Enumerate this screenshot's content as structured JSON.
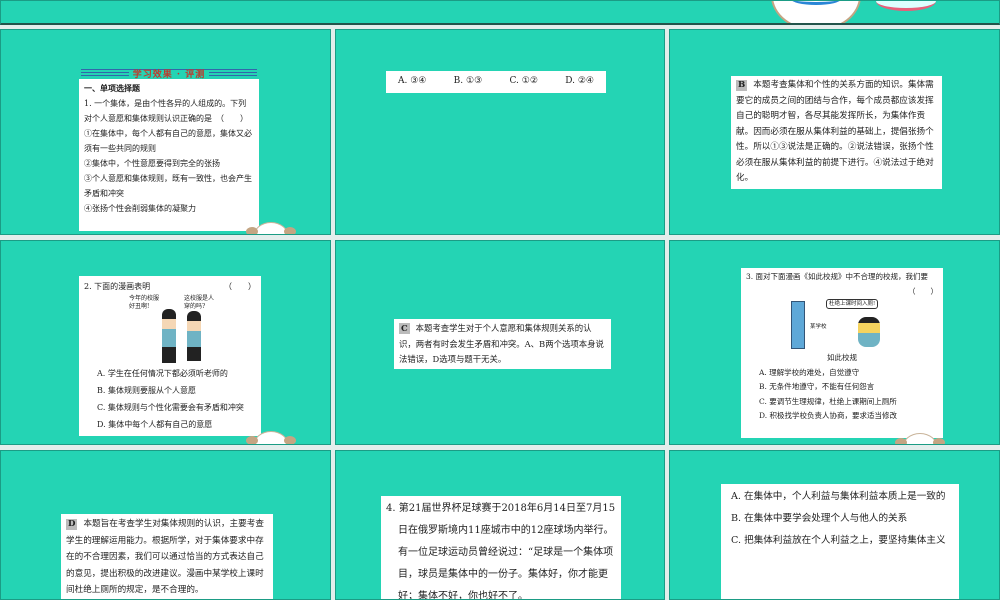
{
  "slide1": {
    "header": "学习效果 · 评测",
    "section": "一、单项选择题",
    "q": "1. 一个集体，是由个性各异的人组成的。下列对个人意愿和集体规则认识正确的是　（　　）",
    "opts": [
      "①在集体中，每个人都有自己的意愿，集体又必须有一些共同的规则",
      "②集体中，个性意愿要得到完全的张扬",
      "③个人意愿和集体规则，既有一致性，也会产生矛盾和冲突",
      "④张扬个性会削弱集体的凝聚力"
    ]
  },
  "slide2": {
    "opts": [
      "A. ③④",
      "B. ①③",
      "C. ①②",
      "D. ②④"
    ]
  },
  "slide3": {
    "tag": "B",
    "text": "本题考查集体和个性的关系方面的知识。集体需要它的成员之间的团结与合作，每个成员都应该发挥自己的聪明才智，各尽其能发挥所长，为集体作贡献。因而必须在服从集体利益的基础上，提倡张扬个性。所以①③说法是正确的。②说法错误，张扬个性必须在服从集体利益的前提下进行。④说法过于绝对化。"
  },
  "slide4": {
    "q": "2. 下面的漫画表明",
    "paren": "（　　）",
    "bubble1": "今年的校服好丑啊!",
    "bubble2": "这校服是人穿的吗?",
    "opts": [
      "A. 学生在任何情况下都必须听老师的",
      "B. 集体规则要服从个人意愿",
      "C. 集体规则与个性化需要会有矛盾和冲突",
      "D. 集体中每个人都有自己的意愿"
    ]
  },
  "slide5": {
    "tag": "C",
    "text": "本题考查学生对于个人意愿和集体规则关系的认识，两者有时会发生矛盾和冲突。A、B两个选项本身说法错误，D选项与题干无关。"
  },
  "slide6": {
    "q": "3. 面对下面漫画《如此校规》中不合理的校规，我们要",
    "paren": "（　　）",
    "bubble": "杜绝上课时间入厕!",
    "sign": "某学校",
    "caption": "如此校规",
    "opts": [
      "A. 理解学校的难处，自觉遵守",
      "B. 无条件地遵守，不能有任何怨言",
      "C. 要调节生理规律，杜绝上课期间上厕所",
      "D. 积极找学校负责人协商，要求适当修改"
    ]
  },
  "slide7": {
    "tag": "D",
    "text": "本题旨在考查学生对集体规则的认识，主要考查学生的理解运用能力。根据所学，对于集体要求中存在的不合理因素，我们可以通过恰当的方式表达自己的意见，提出积极的改进建议。漫画中某学校上课时间杜绝上厕所的规定，是不合理的。"
  },
  "slide8": {
    "text": "4. 第21届世界杯足球赛于2018年6月14日至7月15日在俄罗斯境内11座城市中的12座球场内举行。有一位足球运动员曾经说过：“足球是一个集体项目，球员是集体中的一份子。集体好，你才能更好；集体不好，你也好不了。"
  },
  "slide9": {
    "opts": [
      "A. 在集体中，个人利益与集体利益本质上是一致的",
      "B. 在集体中要学会处理个人与他人的关系",
      "C. 把集体利益放在个人利益之上，要坚持集体主义"
    ]
  },
  "colors": {
    "teal": "#24d4b4",
    "gap": "#e3eeec"
  }
}
